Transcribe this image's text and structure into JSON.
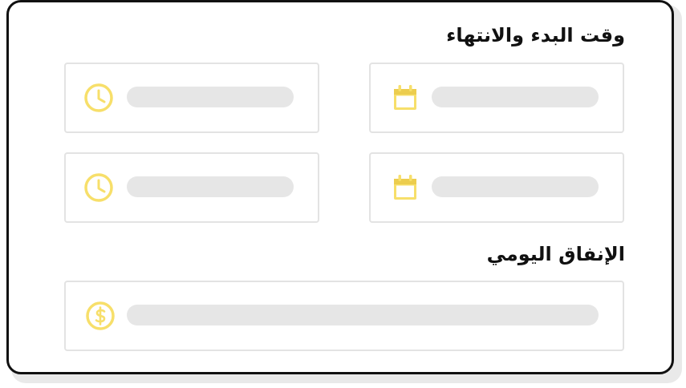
{
  "form": {
    "start_end_section": {
      "title": "وقت البدء والانتهاء"
    },
    "daily_spend_section": {
      "title": "الإنفاق اليومي"
    },
    "icons": {
      "calendar": "calendar-icon",
      "clock": "clock-icon",
      "currency": "dollar-icon"
    },
    "colors": {
      "accent": "#f7df6a",
      "field_border": "#e3e3e3",
      "placeholder_bar": "#e6e6e6",
      "frame": "#111111"
    }
  }
}
